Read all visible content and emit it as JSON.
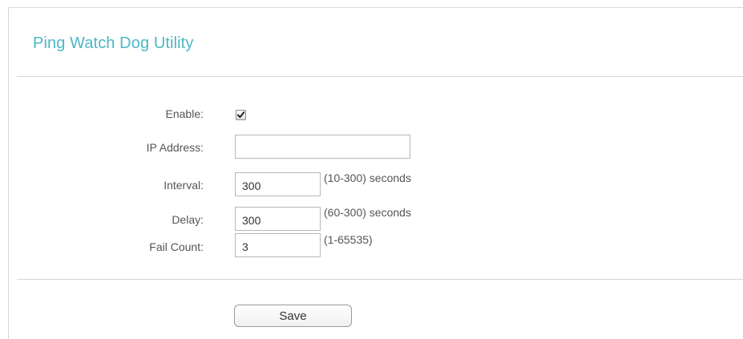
{
  "page": {
    "title": "Ping Watch Dog Utility",
    "accent_color": "#4cb7c6"
  },
  "form": {
    "enable": {
      "label": "Enable:",
      "checked": true,
      "icon": "checkmark-icon"
    },
    "ip_address": {
      "label": "IP Address:",
      "value": ""
    },
    "interval": {
      "label": "Interval:",
      "value": "300",
      "hint": "(10-300) seconds"
    },
    "delay": {
      "label": "Delay:",
      "value": "300",
      "hint": "(60-300) seconds"
    },
    "fail_count": {
      "label": "Fail Count:",
      "value": "3",
      "hint": "(1-65535)"
    }
  },
  "actions": {
    "save_label": "Save"
  }
}
